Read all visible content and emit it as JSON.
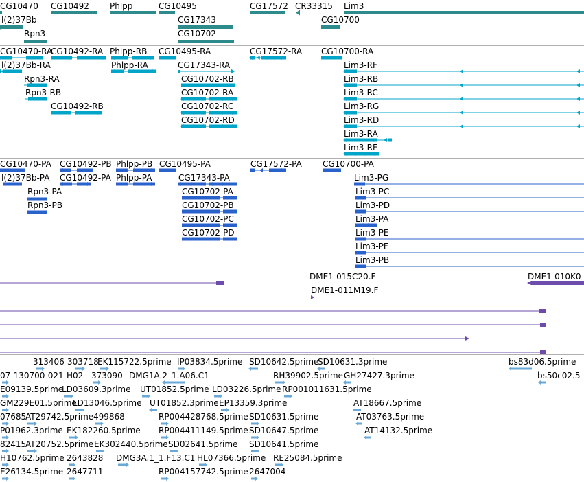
{
  "colors": {
    "gene": "#2e8b8b",
    "transcript": "#00a5c8",
    "protein": "#2a62cc",
    "clone": "#6e4cab",
    "est": "#6aa8d8"
  },
  "tracks": {
    "genes": [
      "CG10470",
      "CG10492",
      "Phlpp",
      "CG10495",
      "CG17572",
      "CR33315",
      "Lim3",
      "l(2)37Bb",
      "CG17343",
      "CG10700",
      "Rpn3",
      "CG10702"
    ],
    "transcripts": [
      "CG10470-RA",
      "CG10492-RA",
      "Phlpp-RB",
      "CG10495-RA",
      "CG17572-RA",
      "CG10700-RA",
      "l(2)37Bb-RA",
      "Phlpp-RA",
      "CG17343-RA",
      "Lim3-RF",
      "Rpn3-RA",
      "CG10702-RB",
      "Lim3-RB",
      "Rpn3-RB",
      "CG10702-RA",
      "Lim3-RC",
      "CG10492-RB",
      "CG10702-RC",
      "Lim3-RG",
      "CG10702-RD",
      "Lim3-RD",
      "Lim3-RA",
      "Lim3-RE"
    ],
    "proteins": [
      "CG10470-PA",
      "CG10492-PB",
      "Phlpp-PB",
      "CG10495-PA",
      "CG17572-PA",
      "CG10700-PA",
      "l(2)37Bb-PA",
      "CG10492-PA",
      "Phlpp-PA",
      "CG17343-PA",
      "Lim3-PG",
      "Rpn3-PA",
      "CG10702-PA",
      "Lim3-PC",
      "Rpn3-PB",
      "CG10702-PB",
      "Lim3-PD",
      "CG10702-PC",
      "Lim3-PA",
      "CG10702-PD",
      "Lim3-PE",
      "Lim3-PF",
      "Lim3-PB"
    ],
    "clones": [
      "DME1-015C20.F",
      "DME1-010K0",
      "DME1-011M19.F"
    ],
    "ests": [
      "313406",
      "303718",
      "EK115722.5prime",
      "IP03834.5prime",
      "SD10642.5prime",
      "SD10631.3prime",
      "bs83d06.5prime",
      "07-130700-021-H02",
      "373090",
      "DMG1A.2_1.A06.C1",
      "RH39902.5prime",
      "GH27427.3prime",
      "bs50c02.5",
      "E09139.5prime",
      "LD03609.3prime",
      "UT01852.5prime",
      "LD03226.5prime",
      "RP001011631.5prime",
      "GM229E01.5prime",
      "LD13046.5prime",
      "UT01852.3prime",
      "EP13359.3prime",
      "AT18667.5prime",
      "07685",
      "AT29742.5prime",
      "499868",
      "RP004428768.5prime",
      "SD10631.5prime",
      "AT03763.5prime",
      "P01962.3prime",
      "EK182260.5prime",
      "RP004411149.5prime",
      "SD10647.5prime",
      "AT14132.5prime",
      "82415",
      "AT20752.5prime",
      "EK302440.5prime",
      "SD02641.5prime",
      "SD10641.5prime",
      "H10762.5prime",
      "2643828",
      "DMG3A.1_1.F13.C1",
      "HL07366.5prime",
      "RE25084.5prime",
      "E26134.5prime",
      "2647711",
      "RP004157742.5prime",
      "2647004"
    ]
  }
}
